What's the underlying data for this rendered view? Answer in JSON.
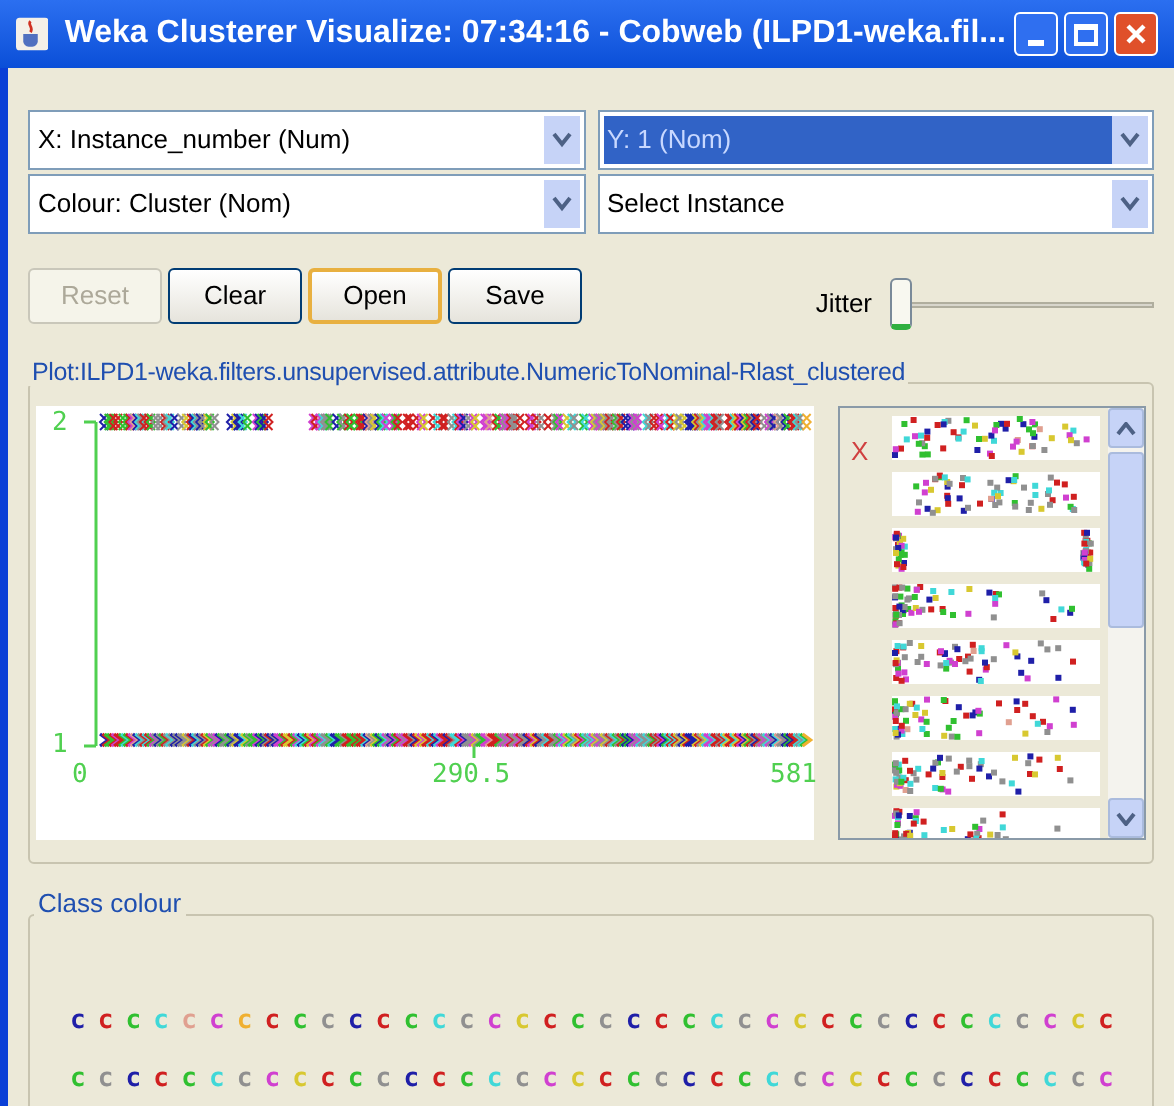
{
  "window": {
    "title": "Weka Clusterer Visualize: 07:34:16 - Cobweb (ILPD1-weka.fil..."
  },
  "selectors": [
    {
      "value": "X: Instance_number (Num)",
      "selected": false
    },
    {
      "value": "Y: 1 (Nom)",
      "selected": true
    },
    {
      "value": "Colour: Cluster (Nom)",
      "selected": false
    },
    {
      "value": "Select Instance",
      "selected": false
    }
  ],
  "buttons": [
    {
      "label": "Reset",
      "disabled": true,
      "focused": false
    },
    {
      "label": "Clear",
      "disabled": false,
      "focused": false
    },
    {
      "label": "Open",
      "disabled": false,
      "focused": true
    },
    {
      "label": "Save",
      "disabled": false,
      "focused": false
    }
  ],
  "jitter": {
    "label": "Jitter",
    "level": 0
  },
  "plot": {
    "title": "Plot:ILPD1-weka.filters.unsupervised.attribute.NumericToNominal-Rlast_clustered",
    "y_labels": [
      "2",
      "1"
    ],
    "x_labels": [
      "0",
      "290.5",
      "581"
    ]
  },
  "attribute_panel": {
    "marker": "X"
  },
  "class_colour": {
    "title": "Class colour",
    "rows": [
      [
        {
          "label": "c",
          "color": "#1f1fa8"
        },
        {
          "label": "c",
          "color": "#d02020"
        },
        {
          "label": "c",
          "color": "#30c030"
        },
        {
          "label": "c",
          "color": "#40d8d8"
        },
        {
          "label": "c",
          "color": "#e0a090"
        },
        {
          "label": "c",
          "color": "#d040d0"
        },
        {
          "label": "c",
          "color": "#f0b030"
        },
        {
          "label": "c",
          "color": "#d02020"
        },
        {
          "label": "c",
          "color": "#30c030"
        },
        {
          "label": "c",
          "color": "#909090"
        },
        {
          "label": "c",
          "color": "#1f1fa8"
        },
        {
          "label": "c",
          "color": "#d02020"
        },
        {
          "label": "c",
          "color": "#30c030"
        },
        {
          "label": "c",
          "color": "#40d8d8"
        },
        {
          "label": "c",
          "color": "#909090"
        },
        {
          "label": "c",
          "color": "#d040d0"
        },
        {
          "label": "c",
          "color": "#d8c830"
        },
        {
          "label": "c",
          "color": "#d02020"
        },
        {
          "label": "c",
          "color": "#30c030"
        },
        {
          "label": "c",
          "color": "#909090"
        },
        {
          "label": "c",
          "color": "#1f1fa8"
        },
        {
          "label": "c",
          "color": "#d02020"
        },
        {
          "label": "c",
          "color": "#30c030"
        },
        {
          "label": "c",
          "color": "#40d8d8"
        },
        {
          "label": "c",
          "color": "#909090"
        },
        {
          "label": "c",
          "color": "#d040d0"
        },
        {
          "label": "c",
          "color": "#d8c830"
        },
        {
          "label": "c",
          "color": "#d02020"
        },
        {
          "label": "c",
          "color": "#30c030"
        },
        {
          "label": "c",
          "color": "#909090"
        },
        {
          "label": "c",
          "color": "#1f1fa8"
        },
        {
          "label": "c",
          "color": "#d02020"
        },
        {
          "label": "c",
          "color": "#30c030"
        },
        {
          "label": "c",
          "color": "#40d8d8"
        },
        {
          "label": "c",
          "color": "#909090"
        },
        {
          "label": "c",
          "color": "#d040d0"
        },
        {
          "label": "c",
          "color": "#d8c830"
        },
        {
          "label": "c",
          "color": "#d02020"
        }
      ],
      [
        {
          "label": "c",
          "color": "#30c030"
        },
        {
          "label": "c",
          "color": "#909090"
        },
        {
          "label": "c",
          "color": "#1f1fa8"
        },
        {
          "label": "c",
          "color": "#d02020"
        },
        {
          "label": "c",
          "color": "#30c030"
        },
        {
          "label": "c",
          "color": "#40d8d8"
        },
        {
          "label": "c",
          "color": "#909090"
        },
        {
          "label": "c",
          "color": "#d040d0"
        },
        {
          "label": "c",
          "color": "#d8c830"
        },
        {
          "label": "c",
          "color": "#d02020"
        },
        {
          "label": "c",
          "color": "#30c030"
        },
        {
          "label": "c",
          "color": "#909090"
        },
        {
          "label": "c",
          "color": "#1f1fa8"
        },
        {
          "label": "c",
          "color": "#d02020"
        },
        {
          "label": "c",
          "color": "#30c030"
        },
        {
          "label": "c",
          "color": "#40d8d8"
        },
        {
          "label": "c",
          "color": "#909090"
        },
        {
          "label": "c",
          "color": "#d040d0"
        },
        {
          "label": "c",
          "color": "#d8c830"
        },
        {
          "label": "c",
          "color": "#d02020"
        },
        {
          "label": "c",
          "color": "#30c030"
        },
        {
          "label": "c",
          "color": "#909090"
        },
        {
          "label": "c",
          "color": "#1f1fa8"
        },
        {
          "label": "c",
          "color": "#d02020"
        },
        {
          "label": "c",
          "color": "#30c030"
        },
        {
          "label": "c",
          "color": "#40d8d8"
        },
        {
          "label": "c",
          "color": "#909090"
        },
        {
          "label": "c",
          "color": "#d040d0"
        },
        {
          "label": "c",
          "color": "#d8c830"
        },
        {
          "label": "c",
          "color": "#d02020"
        },
        {
          "label": "c",
          "color": "#30c030"
        },
        {
          "label": "c",
          "color": "#909090"
        },
        {
          "label": "c",
          "color": "#1f1fa8"
        },
        {
          "label": "c",
          "color": "#d02020"
        },
        {
          "label": "c",
          "color": "#30c030"
        },
        {
          "label": "c",
          "color": "#40d8d8"
        },
        {
          "label": "c",
          "color": "#909090"
        },
        {
          "label": "c",
          "color": "#d040d0"
        }
      ]
    ]
  }
}
